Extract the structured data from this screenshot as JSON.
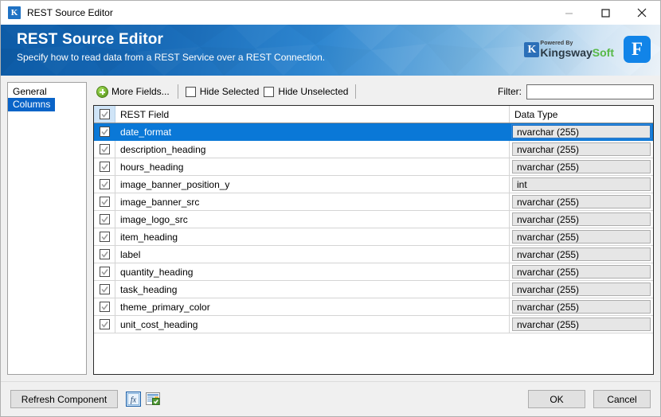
{
  "window": {
    "title": "REST Source Editor",
    "app_icon": "k-logo-icon",
    "minimize_label": "Minimize",
    "maximize_label": "Maximize",
    "close_label": "Close"
  },
  "banner": {
    "title": "REST Source Editor",
    "subtitle": "Specify how to read data from a REST Service over a REST Connection.",
    "brand_powered": "Powered By",
    "brand_k": "K",
    "brand_name_part1": "Kingsway",
    "brand_name_part2": "Soft",
    "product_badge": "F",
    "gradient_start": "#0d5ba6",
    "gradient_end": "#eef5fb"
  },
  "sidebar": {
    "items": [
      {
        "label": "General",
        "selected": false
      },
      {
        "label": "Columns",
        "selected": true
      }
    ]
  },
  "toolbar": {
    "more_fields_label": "More Fields...",
    "hide_selected_label": "Hide Selected",
    "hide_selected_checked": false,
    "hide_unselected_label": "Hide Unselected",
    "hide_unselected_checked": false,
    "filter_label": "Filter:",
    "filter_value": "",
    "filter_placeholder": ""
  },
  "grid": {
    "header": {
      "select_all_checked": true,
      "col_field": "REST Field",
      "col_type": "Data Type"
    },
    "rows": [
      {
        "checked": true,
        "field": "date_format",
        "type": "nvarchar (255)",
        "selected": true
      },
      {
        "checked": true,
        "field": "description_heading",
        "type": "nvarchar (255)",
        "selected": false
      },
      {
        "checked": true,
        "field": "hours_heading",
        "type": "nvarchar (255)",
        "selected": false
      },
      {
        "checked": true,
        "field": "image_banner_position_y",
        "type": "int",
        "selected": false
      },
      {
        "checked": true,
        "field": "image_banner_src",
        "type": "nvarchar (255)",
        "selected": false
      },
      {
        "checked": true,
        "field": "image_logo_src",
        "type": "nvarchar (255)",
        "selected": false
      },
      {
        "checked": true,
        "field": "item_heading",
        "type": "nvarchar (255)",
        "selected": false
      },
      {
        "checked": true,
        "field": "label",
        "type": "nvarchar (255)",
        "selected": false
      },
      {
        "checked": true,
        "field": "quantity_heading",
        "type": "nvarchar (255)",
        "selected": false
      },
      {
        "checked": true,
        "field": "task_heading",
        "type": "nvarchar (255)",
        "selected": false
      },
      {
        "checked": true,
        "field": "theme_primary_color",
        "type": "nvarchar (255)",
        "selected": false
      },
      {
        "checked": true,
        "field": "unit_cost_heading",
        "type": "nvarchar (255)",
        "selected": false
      }
    ]
  },
  "footer": {
    "refresh_label": "Refresh Component",
    "fx_icon": "fx-expression-icon",
    "sheet_icon": "spreadsheet-export-icon",
    "ok_label": "OK",
    "cancel_label": "Cancel"
  }
}
